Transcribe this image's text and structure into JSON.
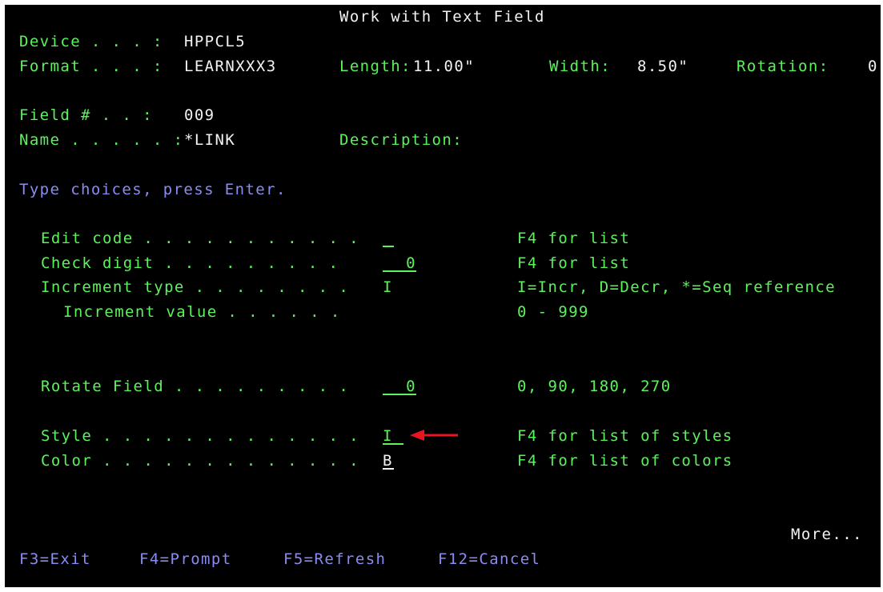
{
  "screen_title": "Work with Text Field",
  "header": {
    "device_label": "Device . . . :",
    "device_value": "HPPCL5",
    "format_label": "Format . . . :",
    "format_value": "LEARNXXX3",
    "length_label": "Length:",
    "length_value": "11.00\"",
    "width_label": "Width:",
    "width_value": "8.50\"",
    "rotation_label": "Rotation:",
    "rotation_value": "0",
    "field_num_label": "Field # . . :",
    "field_num_value": "009",
    "name_label": "Name . . . . . :",
    "name_value": "*LINK",
    "description_label": "Description:"
  },
  "instructions": "Type choices, press Enter.",
  "fields": {
    "edit_code": {
      "label": "Edit code . . . . . . . . . . .",
      "value": "_",
      "hint": "F4 for list"
    },
    "check_digit": {
      "label": "Check digit . . . . . . . . .",
      "value": "0",
      "hint": "F4 for list"
    },
    "increment_type": {
      "label": "Increment type . . . . . . . .",
      "value": "I",
      "hint": "I=Incr, D=Decr, *=Seq reference"
    },
    "increment_value": {
      "label": "Increment value . . . . . .",
      "value": "",
      "hint": "0 - 999"
    },
    "rotate_field": {
      "label": "Rotate Field . . . . . . . . .",
      "value": "0",
      "hint": "0, 90, 180, 270"
    },
    "style": {
      "label": "Style . . . . . . . . . . . . .",
      "value": "I",
      "hint": "F4 for list of styles"
    },
    "color": {
      "label": "Color . . . . . . . . . . . . .",
      "value": "B",
      "hint": "F4 for list of colors"
    }
  },
  "more_indicator": "More...",
  "function_keys": {
    "f3": "F3=Exit",
    "f4": "F4=Prompt",
    "f5": "F5=Refresh",
    "f12": "F12=Cancel"
  },
  "annotation": {
    "arrow_color": "#e8141e"
  },
  "colors": {
    "background": "#000000",
    "green": "#5cf25c",
    "white": "#f2f2f2",
    "blue": "#8a8cf2"
  }
}
